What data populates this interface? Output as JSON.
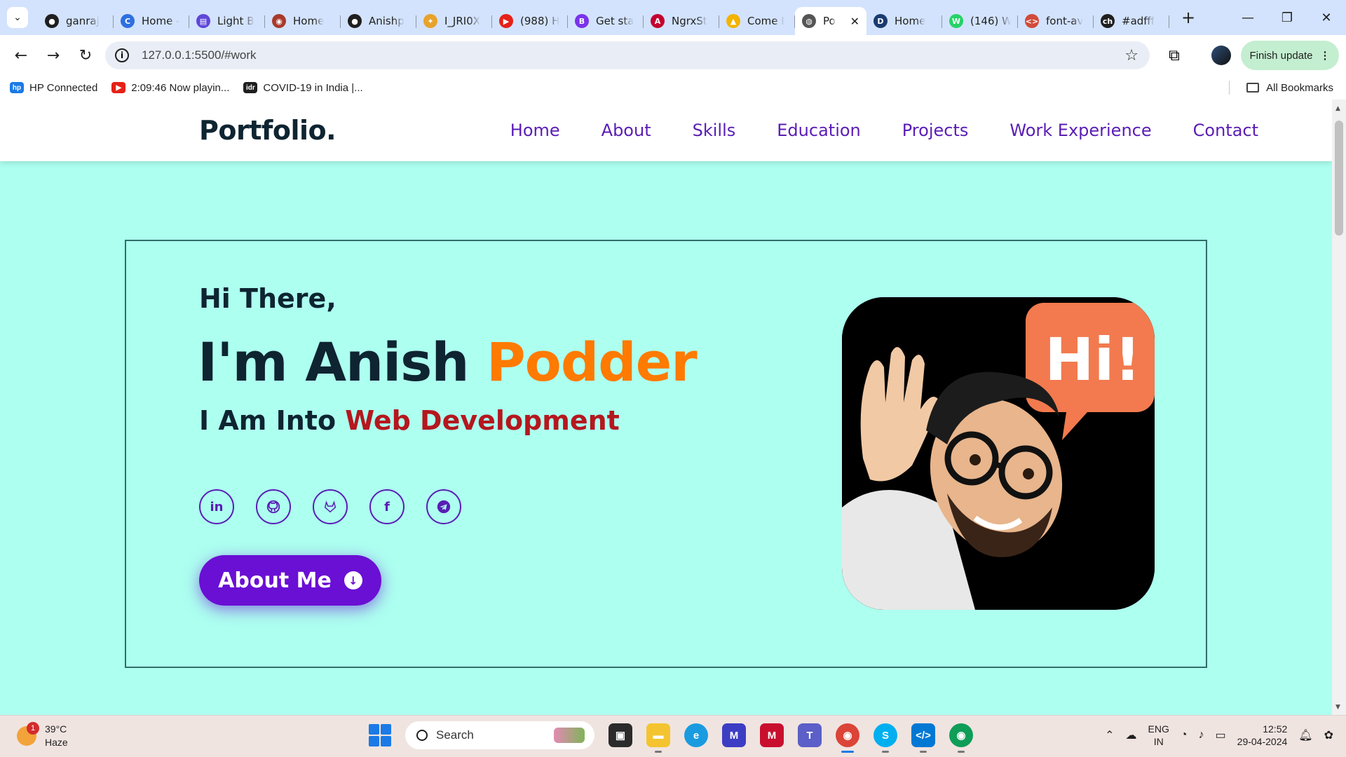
{
  "browser": {
    "tabs": [
      {
        "label": "ganraj",
        "icon": "github-icon",
        "color": "#1f1f1f",
        "glyph": "●"
      },
      {
        "label": "Home -",
        "icon": "chrome-c-icon",
        "color": "#2e6fe0",
        "glyph": "C"
      },
      {
        "label": "Light B",
        "icon": "docs-icon",
        "color": "#5f46d8",
        "glyph": "▤"
      },
      {
        "label": "Home",
        "icon": "emblem-icon",
        "color": "#a83a2b",
        "glyph": "◉"
      },
      {
        "label": "Anishp",
        "icon": "github-icon",
        "color": "#1f1f1f",
        "glyph": "●"
      },
      {
        "label": "I_JRI0X",
        "icon": "pinwheel-icon",
        "color": "#e8a32a",
        "glyph": "✦"
      },
      {
        "label": "(988) H",
        "icon": "youtube-icon",
        "color": "#e62117",
        "glyph": "▶"
      },
      {
        "label": "Get sta",
        "icon": "bootstrap-icon",
        "color": "#7a33ea",
        "glyph": "B"
      },
      {
        "label": "NgrxSt",
        "icon": "angular-icon",
        "color": "#c3002f",
        "glyph": "A"
      },
      {
        "label": "Come I",
        "icon": "drive-icon",
        "color": "#f3b300",
        "glyph": "▲"
      },
      {
        "label": "Po",
        "icon": "globe-icon",
        "color": "#555555",
        "glyph": "◍",
        "active": true
      },
      {
        "label": "Home",
        "icon": "dp-icon",
        "color": "#1b3b6f",
        "glyph": "D"
      },
      {
        "label": "(146) W",
        "icon": "whatsapp-icon",
        "color": "#25d366",
        "glyph": "W"
      },
      {
        "label": "font-av",
        "icon": "code-icon",
        "color": "#d14a3a",
        "glyph": "<>"
      },
      {
        "label": "#adfff",
        "icon": "ch-icon",
        "color": "#1f1f1f",
        "glyph": "ch"
      }
    ],
    "url": "127.0.0.1:5500/#work",
    "finish_update": "Finish update",
    "bookmarks": [
      {
        "label": "HP Connected",
        "icon": "hp-icon",
        "color": "#1b7ae6",
        "glyph": "hp"
      },
      {
        "label": "2:09:46 Now playin...",
        "icon": "youtube-icon",
        "color": "#e62117",
        "glyph": "▶"
      },
      {
        "label": "COVID-19 in India |...",
        "icon": "idr-icon",
        "color": "#1f1f1f",
        "glyph": "idr"
      }
    ],
    "all_bookmarks": "All Bookmarks"
  },
  "site": {
    "logo": "Portfolio.",
    "nav": [
      "Home",
      "About",
      "Skills",
      "Education",
      "Projects",
      "Work Experience",
      "Contact"
    ],
    "greeting": "Hi There,",
    "name_prefix": "I'm Anish ",
    "name_accent": "Podder",
    "into_prefix": "I Am Into ",
    "into_accent": "Web Development",
    "socials": [
      "linkedin-icon",
      "github-icon",
      "gitlab-icon",
      "facebook-icon",
      "telegram-icon"
    ],
    "about_button": "About Me",
    "avatar_bubble": "Hi!",
    "colors": {
      "background": "#adfff0",
      "nav": "#5a1db5",
      "accent_orange": "#ff7a00",
      "accent_red": "#b5171e",
      "button": "#6a0fd4"
    }
  },
  "taskbar": {
    "temperature": "39°C",
    "condition": "Haze",
    "weather_badge": "1",
    "search": "Search",
    "lang_top": "ENG",
    "lang_bottom": "IN",
    "time": "12:52",
    "date": "29-04-2024"
  }
}
